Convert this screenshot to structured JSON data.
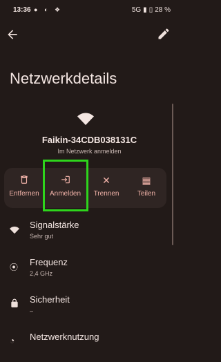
{
  "status": {
    "time": "13:36",
    "network": "5G",
    "battery": "28 %"
  },
  "header": {
    "title": "Netzwerkdetails"
  },
  "network": {
    "ssid": "Faikin-34CDB038131C",
    "action_hint": "Im Netzwerk anmelden"
  },
  "actions": [
    {
      "label": "Entfernen",
      "icon": "trash-icon"
    },
    {
      "label": "Anmelden",
      "icon": "login-icon"
    },
    {
      "label": "Trennen",
      "icon": "close-icon"
    },
    {
      "label": "Teilen",
      "icon": "qr-code-icon"
    }
  ],
  "details": [
    {
      "title": "Signalstärke",
      "value": "Sehr gut",
      "icon": "wifi-icon"
    },
    {
      "title": "Frequenz",
      "value": "2,4 GHz",
      "icon": "antenna-icon"
    },
    {
      "title": "Sicherheit",
      "value": "–",
      "icon": "lock-icon"
    },
    {
      "title": "Netzwerknutzung",
      "value": "",
      "icon": "data-usage-icon"
    }
  ],
  "colors": {
    "background": "#221a18",
    "accent": "#f2b3a9",
    "highlight": "#2ed51c"
  }
}
